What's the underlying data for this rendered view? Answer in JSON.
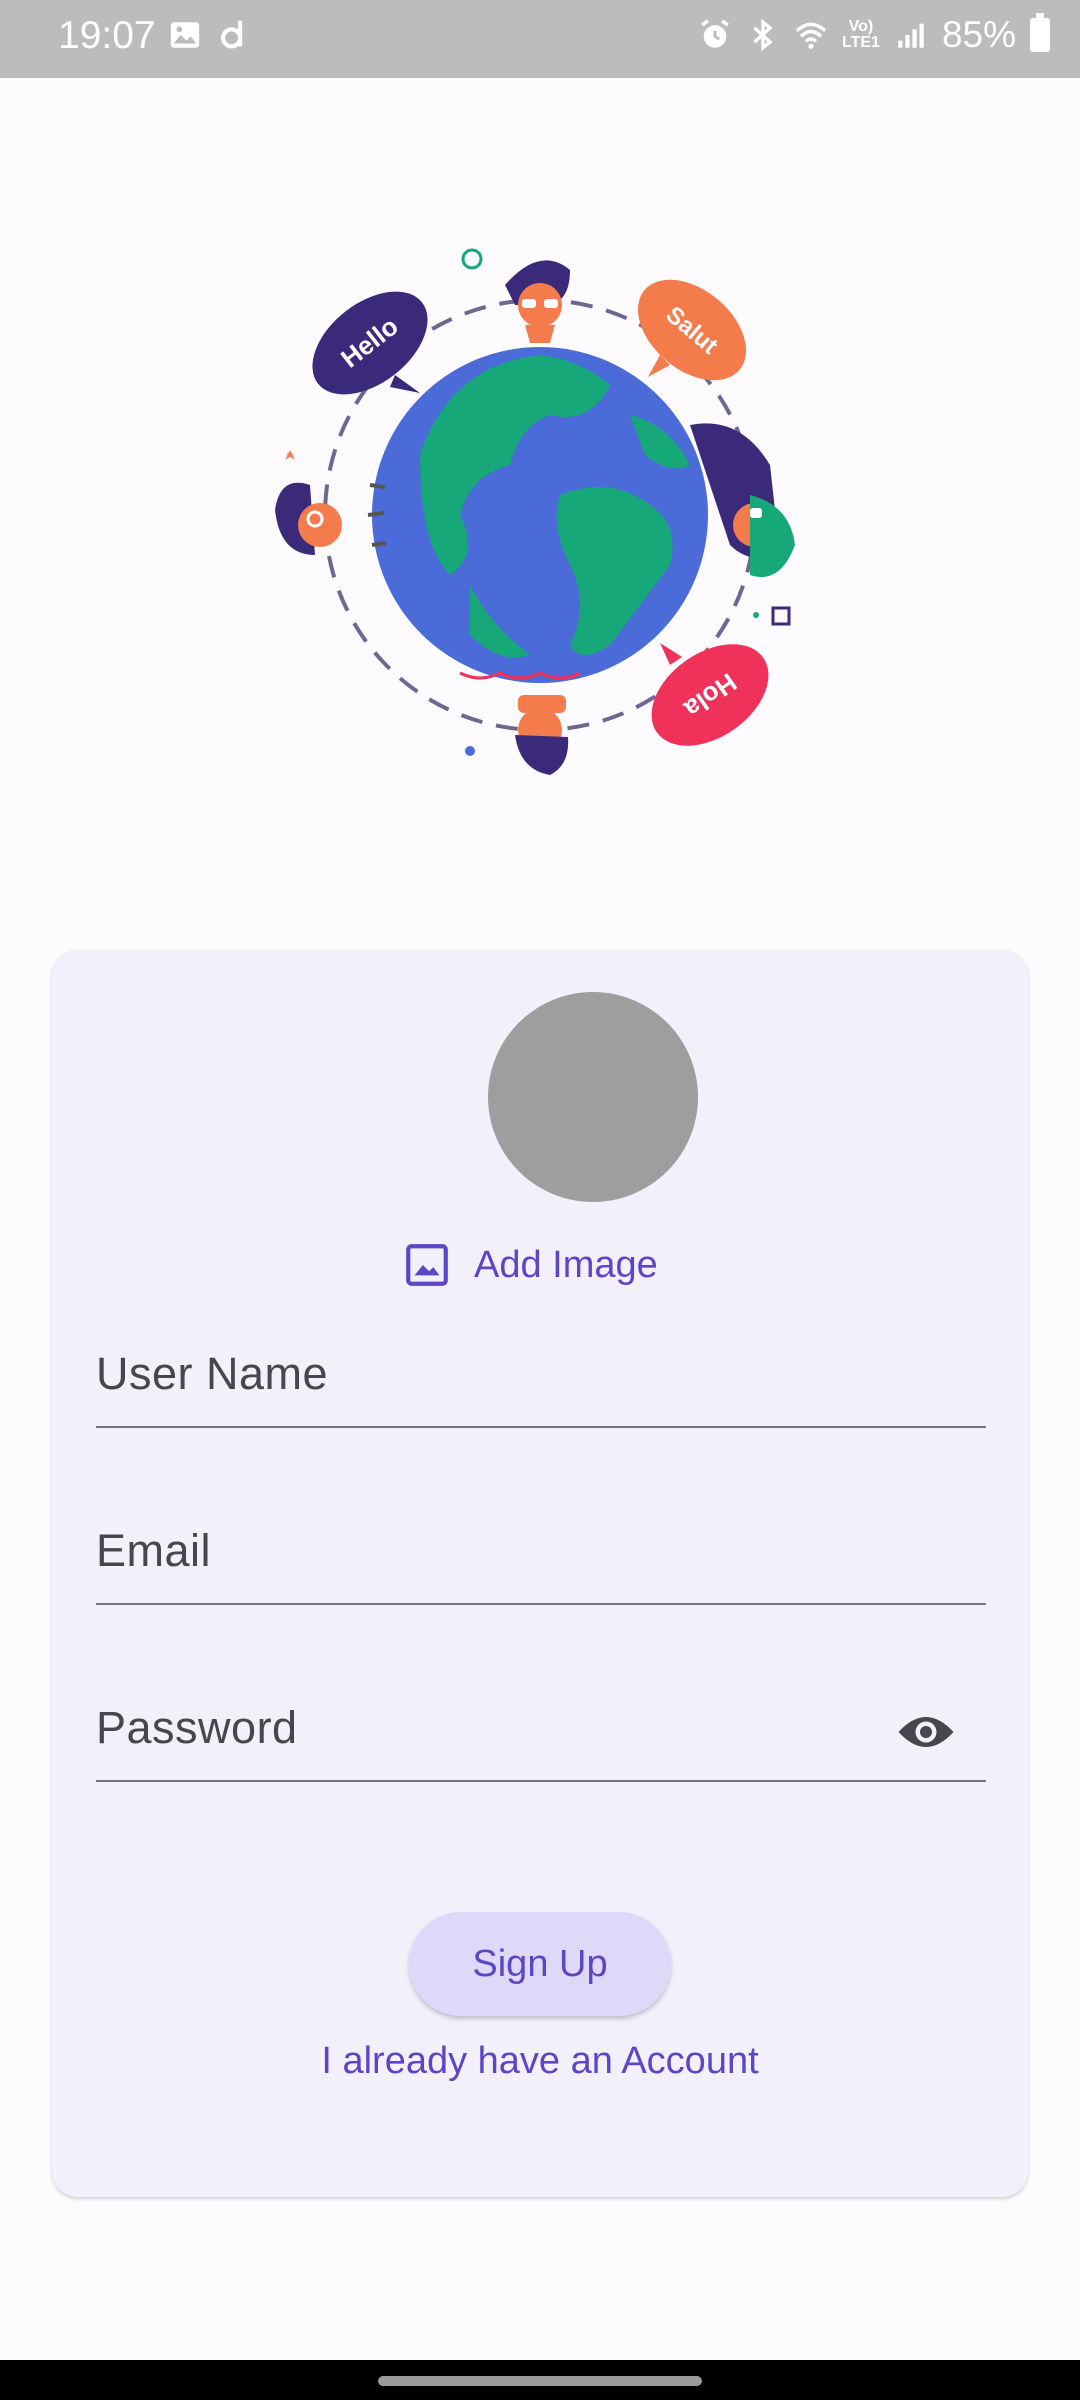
{
  "status_bar": {
    "time": "19:07",
    "battery": "85%",
    "network_badge_top": "Vo)",
    "network_badge_bottom": "LTE1",
    "icons": [
      "image-icon",
      "d-app-icon",
      "alarm-icon",
      "bluetooth-icon",
      "wifi-icon",
      "signal-icon",
      "battery-icon"
    ]
  },
  "hero": {
    "bubbles": [
      "Hello",
      "Salut",
      "Hola"
    ]
  },
  "card": {
    "add_image_label": "Add Image",
    "fields": {
      "username_label": "User Name",
      "email_label": "Email",
      "password_label": "Password"
    },
    "signup_label": "Sign Up",
    "login_link": "I already have an Account"
  },
  "colors": {
    "accent": "#5d46c6",
    "card_bg": "#f4f0fb",
    "page_bg": "#fefbff",
    "avatar": "#9e9e9e",
    "button_bg": "#e0d8f8"
  }
}
